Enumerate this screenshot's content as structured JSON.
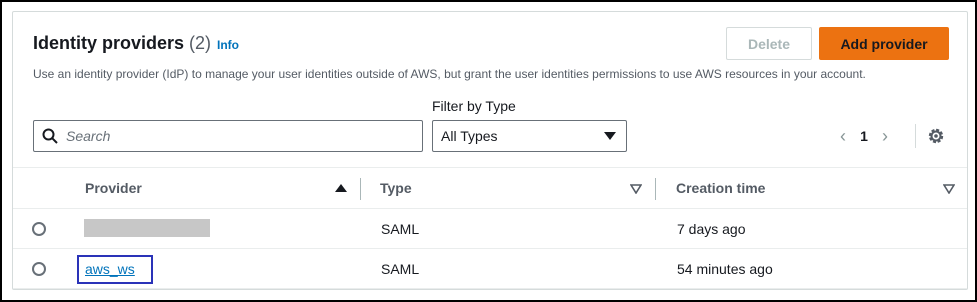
{
  "header": {
    "title": "Identity providers",
    "count": "(2)",
    "info_label": "Info",
    "description": "Use an identity provider (IdP) to manage your user identities outside of AWS, but grant the user identities permissions to use AWS resources in your account."
  },
  "actions": {
    "delete_label": "Delete",
    "add_label": "Add provider"
  },
  "filter": {
    "search_placeholder": "Search",
    "type_label": "Filter by Type",
    "type_value": "All Types"
  },
  "pagination": {
    "current_page": "1",
    "prev_icon": "chevron-left-icon",
    "next_icon": "chevron-right-icon"
  },
  "table": {
    "columns": [
      "Provider",
      "Type",
      "Creation time"
    ],
    "rows": [
      {
        "provider": "",
        "type": "SAML",
        "created": "7 days ago"
      },
      {
        "provider": "aws_ws",
        "type": "SAML",
        "created": "54 minutes ago"
      }
    ]
  },
  "colors": {
    "primary_button": "#ec7211",
    "link": "#0073bb",
    "highlight_box": "#2a33b8"
  }
}
